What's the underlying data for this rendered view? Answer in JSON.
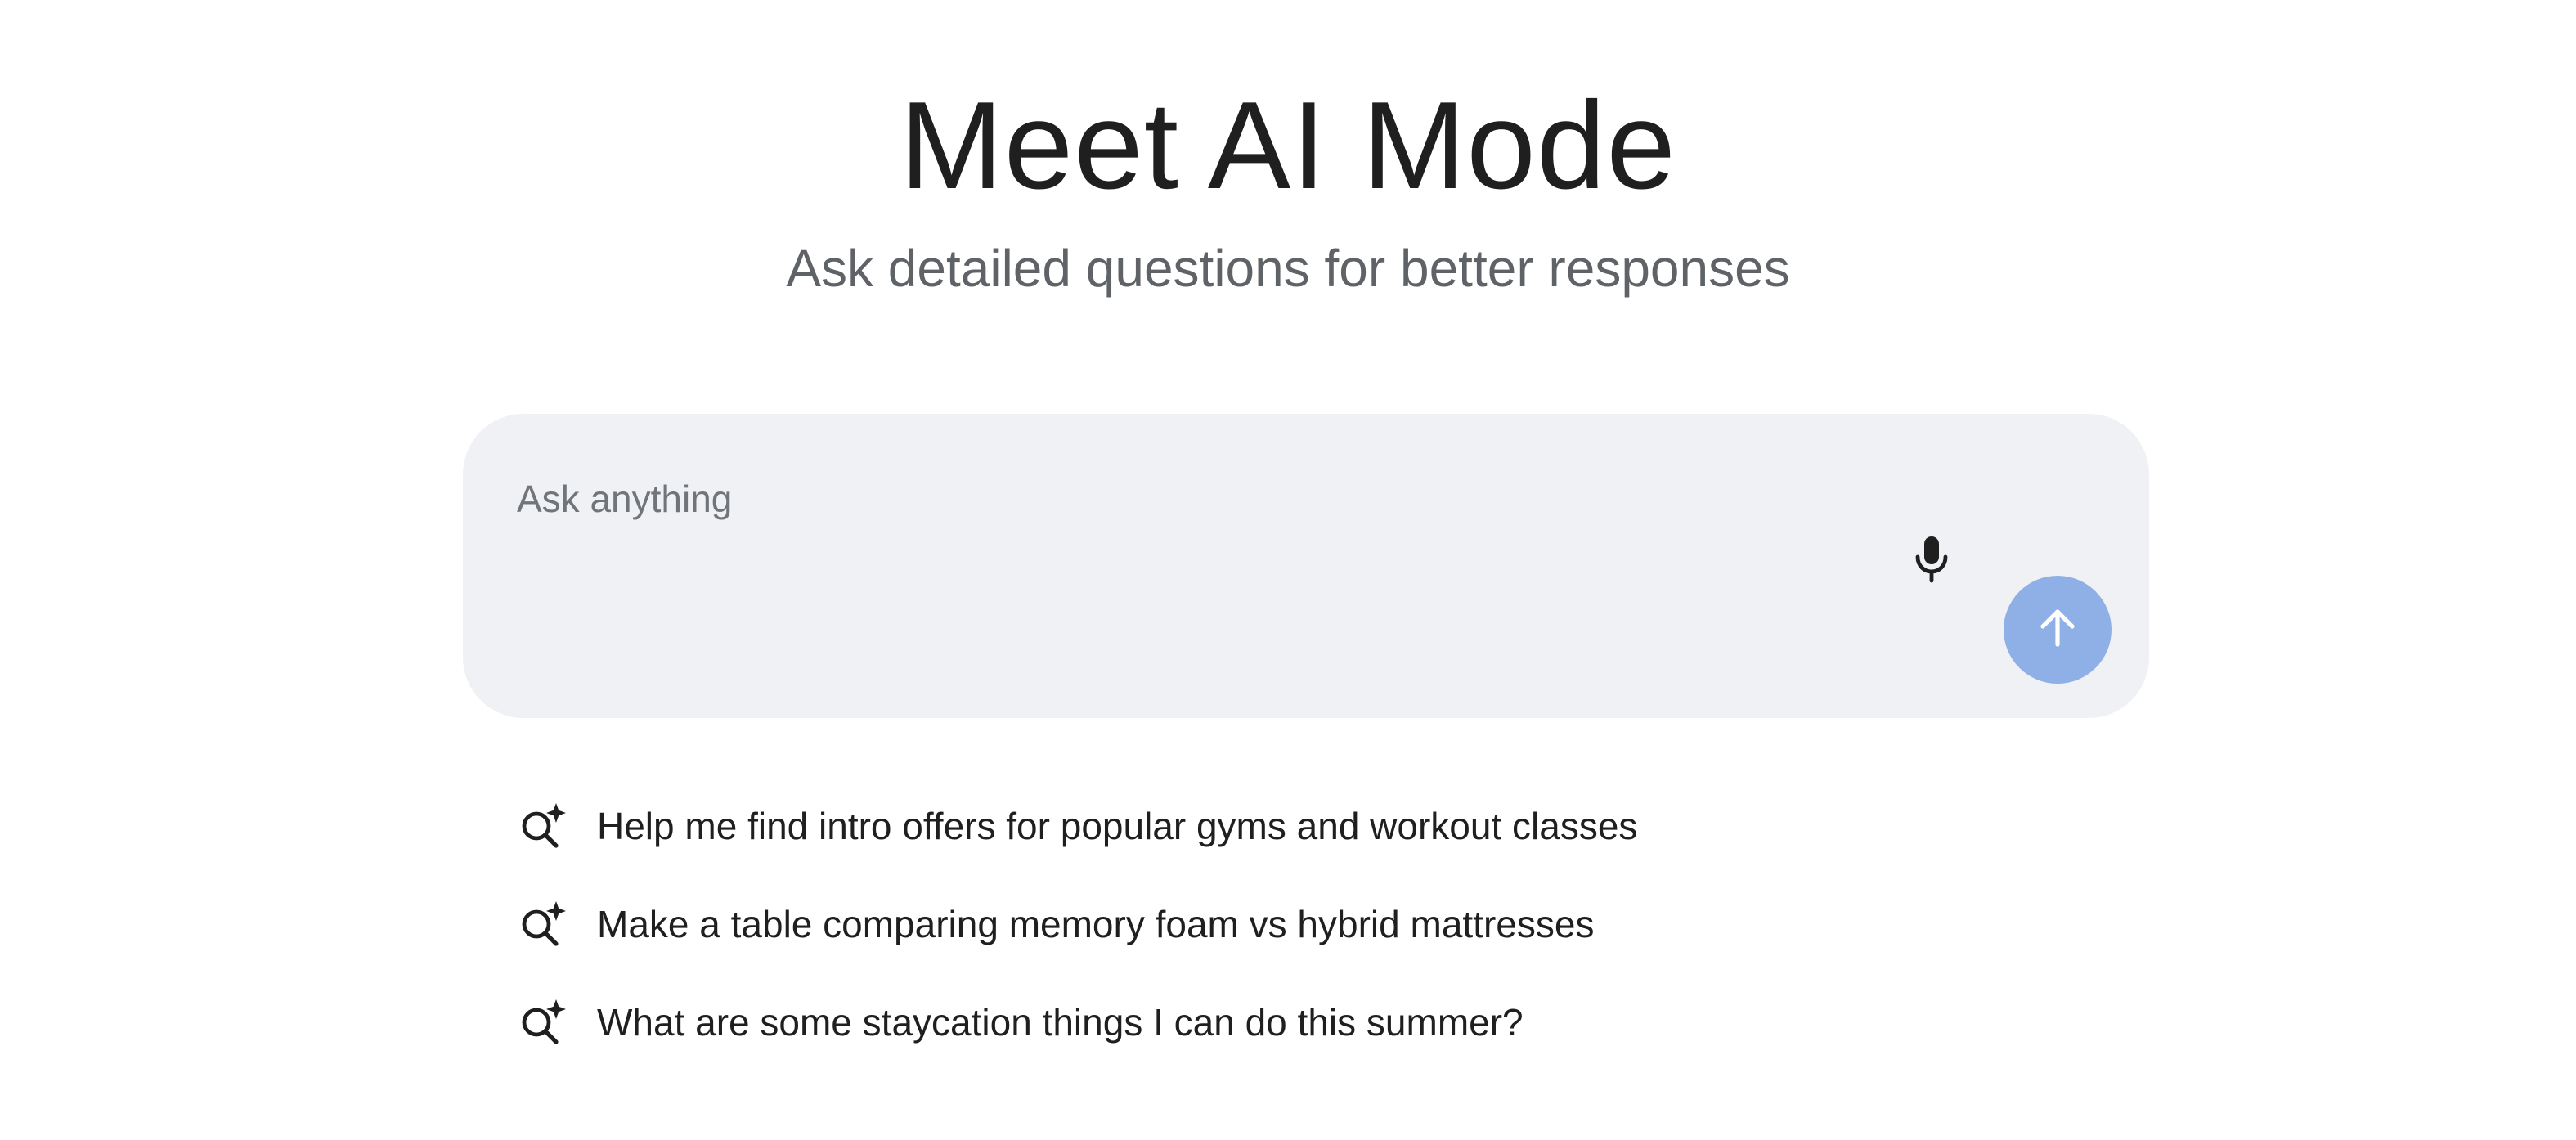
{
  "hero": {
    "title": "Meet AI Mode",
    "subtitle": "Ask detailed questions for better responses"
  },
  "composer": {
    "value": "",
    "placeholder": "Ask anything",
    "mic_icon": "microphone-icon",
    "send_icon": "arrow-up-icon"
  },
  "suggestions": [
    {
      "icon": "search-sparkle-icon",
      "label": "Help me find intro offers for popular gyms and workout classes"
    },
    {
      "icon": "search-sparkle-icon",
      "label": "Make a table comparing memory foam vs hybrid mattresses"
    },
    {
      "icon": "search-sparkle-icon",
      "label": "What are some staycation things I can do this summer?"
    }
  ],
  "colors": {
    "composer_bg": "#f0f1f4",
    "send_button_bg": "#8fb0e6",
    "subtitle": "#5f6368",
    "placeholder": "#70757a"
  }
}
